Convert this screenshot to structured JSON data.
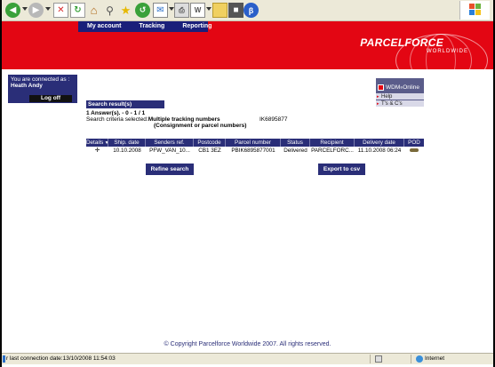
{
  "toolbar": {
    "icons": [
      "back-icon",
      "forward-icon",
      "stop-icon",
      "refresh-icon",
      "home-icon",
      "search-icon",
      "favorites-icon",
      "history-icon",
      "mail-icon",
      "print-icon",
      "edit-icon",
      "folder-icon",
      "messenger-icon",
      "bluetooth-icon"
    ],
    "colors": {
      "back": "#3aa13a",
      "forward": "#b0b0b0",
      "stop": "#d92c2c",
      "refresh": "#3aa13a"
    }
  },
  "header": {
    "nav": [
      "My account",
      "Tracking",
      "Reporting"
    ],
    "logo_main": "PARCELFORCE",
    "logo_sub": "WORLDWIDE",
    "brand_color": "#e30613",
    "nav_color": "#1a1f7a"
  },
  "connection": {
    "label": "You are connected as :",
    "user": "Heath Andy",
    "logoff": "Log off"
  },
  "tools": {
    "title": "WDM",
    "title_sup": "®",
    "title_suffix": " Online",
    "links": [
      "Help",
      "T's & C's"
    ]
  },
  "results": {
    "title": "Search result(s)",
    "answers": "1 Answer(s). - 0 - 1 / 1",
    "criteria_label": "Search criteria selected:",
    "criteria_value": "Multiple tracking numbers",
    "criteria_sub": "(Consignment or parcel numbers)",
    "criteria_id": "IK6895877"
  },
  "table": {
    "columns": [
      "Details",
      "Ship. date",
      "Senders ref.",
      "Postcode",
      "Parcel number",
      "Status",
      "Recipient",
      "Delivery date",
      "POD"
    ],
    "rows": [
      [
        "+",
        "10.10.2008",
        "PFW_VAN_10...",
        "CB1 3EZ",
        "PBIK6895877001",
        "Delivered",
        "PARCELFORC...",
        "11.10.2008 06:24",
        ""
      ]
    ]
  },
  "buttons": {
    "refine": "Refine search",
    "export": "Export to csv"
  },
  "footer": {
    "copyright": "© Copyright Parcelforce Worldwide 2007. All rights reserved."
  },
  "statusbar": {
    "text": "r last connection date:13/10/2008 11:54:03",
    "zone": "Internet"
  }
}
